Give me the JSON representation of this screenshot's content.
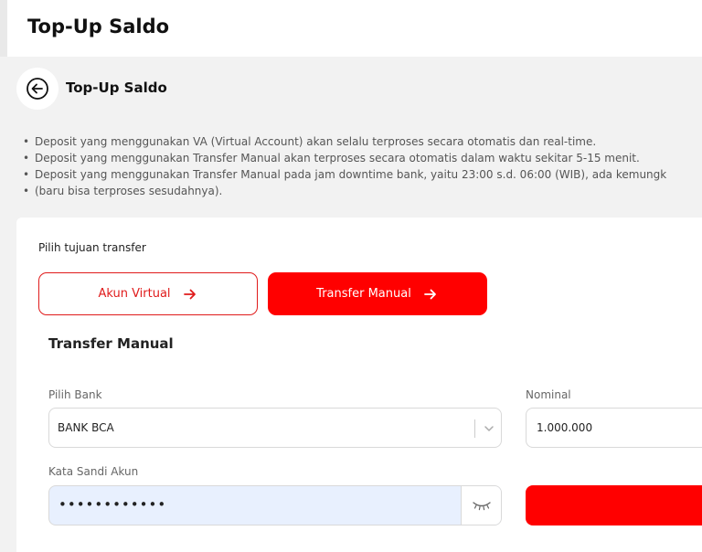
{
  "header": {
    "title": "Top-Up Saldo"
  },
  "page": {
    "title": "Top-Up Saldo"
  },
  "notes": [
    "Deposit yang menggunakan VA (Virtual Account) akan selalu terproses secara otomatis dan real-time.",
    "Deposit yang menggunakan Transfer Manual akan terproses secara otomatis dalam waktu sekitar 5-15 menit.",
    "Deposit yang menggunakan Transfer Manual pada jam downtime bank, yaitu 23:00 s.d. 06:00 (WIB), ada kemungk",
    "(baru bisa terproses sesudahnya)."
  ],
  "transfer": {
    "pick_label": "Pilih tujuan transfer",
    "options": [
      {
        "label": "Akun Virtual",
        "selected": false
      },
      {
        "label": "Transfer Manual",
        "selected": true
      }
    ]
  },
  "form": {
    "title": "Transfer Manual",
    "bank_label": "Pilih Bank",
    "bank_value": "BANK BCA",
    "nominal_label": "Nominal",
    "nominal_value": "1.000.000",
    "password_label": "Kata Sandi Akun",
    "password_value": "••••••••••••"
  },
  "icons": {
    "back": "arrow-left-circle-icon",
    "arrow": "arrow-right-icon",
    "chevron": "chevron-down-icon",
    "eye": "eye-closed-icon"
  },
  "colors": {
    "accent": "#ff0000",
    "outline": "#e01b1b",
    "autofill": "#e8f0fe"
  }
}
